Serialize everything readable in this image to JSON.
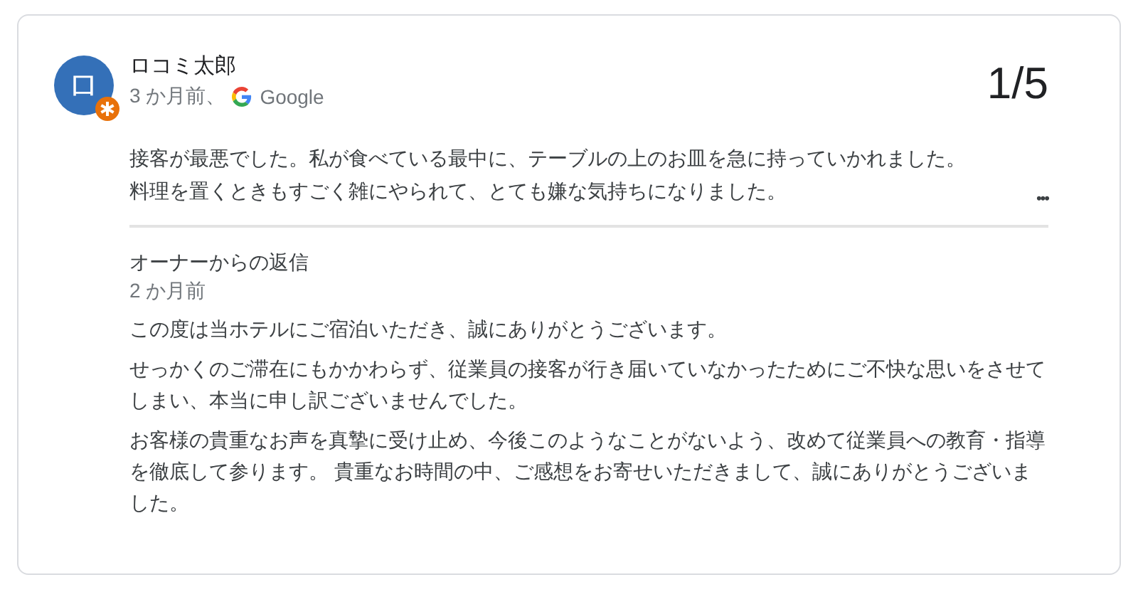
{
  "review": {
    "avatar_letter": "ロ",
    "author": "ロコミ太郎",
    "time": "3 か月前、",
    "source": "Google",
    "rating": "1/5",
    "paragraphs": [
      "接客が最悪でした。私が食べている最中に、テーブルの上のお皿を急に持っていかれました。",
      "料理を置くときもすごく雑にやられて、とても嫌な気持ちになりました。"
    ],
    "more": "•••"
  },
  "reply": {
    "title": "オーナーからの返信",
    "time": "2 か月前",
    "paragraphs": [
      "この度は当ホテルにご宿泊いただき、誠にありがとうございます。",
      "せっかくのご滞在にもかかわらず、従業員の接客が行き届いていなかったためにご不快な思いをさせてしまい、本当に申し訳ございませんでした。",
      "お客様の貴重なお声を真摯に受け止め、今後このようなことがないよう、改めて従業員への教育・指導を徹底して参ります。 貴重なお時間の中、ご感想をお寄せいただきまして、誠にありがとうございました。"
    ]
  }
}
